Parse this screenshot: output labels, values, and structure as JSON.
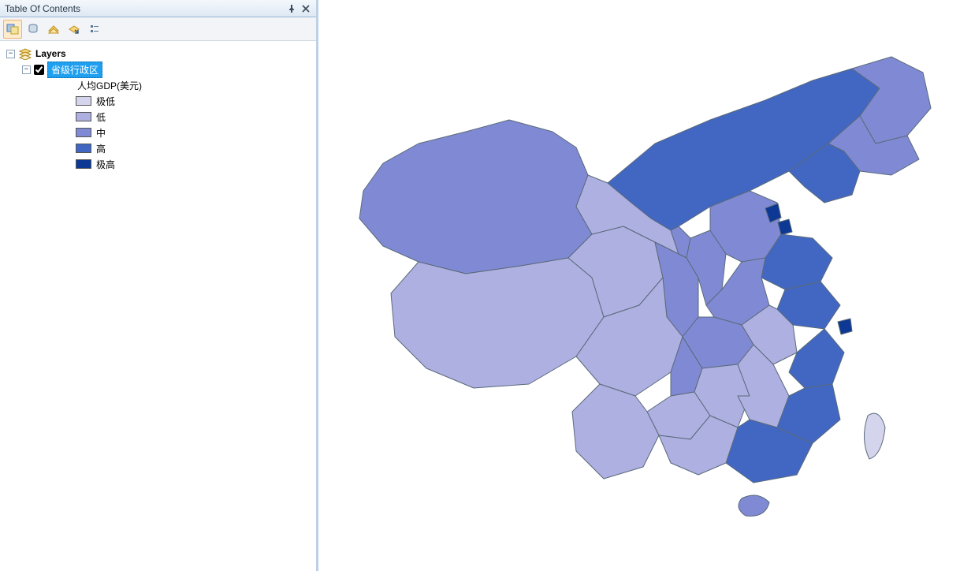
{
  "panel": {
    "title": "Table Of Contents",
    "pin_tooltip": "Auto Hide",
    "close_tooltip": "Close"
  },
  "toolbar": {
    "list_by_drawing_order": "List By Drawing Order",
    "list_by_source": "List By Source",
    "list_by_visibility": "List By Visibility",
    "list_by_selection": "List By Selection",
    "options": "Options"
  },
  "tree": {
    "root_label": "Layers",
    "layer": {
      "name": "省级行政区",
      "checked": true,
      "selected": true,
      "symbology_field": "人均GDP(美元)",
      "classes": [
        {
          "label": "极低",
          "color": "#d4d4ed"
        },
        {
          "label": "低",
          "color": "#aeb0e1"
        },
        {
          "label": "中",
          "color": "#808ad4"
        },
        {
          "label": "高",
          "color": "#4267c2"
        },
        {
          "label": "极高",
          "color": "#0d3894"
        }
      ]
    }
  },
  "map": {
    "theme": "Choropleth of China provinces by per-capita GDP (USD)",
    "legend_field": "人均GDP(美元)",
    "class_colors": {
      "极低": "#d4d4ed",
      "低": "#aeb0e1",
      "中": "#808ad4",
      "高": "#4267c2",
      "极高": "#0d3894"
    },
    "provinces": [
      {
        "name": "Taiwan",
        "class": "极低"
      },
      {
        "name": "Qinghai",
        "class": "低"
      },
      {
        "name": "Tibet",
        "class": "低"
      },
      {
        "name": "Gansu",
        "class": "低"
      },
      {
        "name": "Sichuan",
        "class": "低"
      },
      {
        "name": "Yunnan",
        "class": "低"
      },
      {
        "name": "Guizhou",
        "class": "低"
      },
      {
        "name": "Guangxi",
        "class": "低"
      },
      {
        "name": "Hunan",
        "class": "低"
      },
      {
        "name": "Jiangxi",
        "class": "低"
      },
      {
        "name": "Anhui",
        "class": "低"
      },
      {
        "name": "Xinjiang",
        "class": "中"
      },
      {
        "name": "Ningxia",
        "class": "中"
      },
      {
        "name": "Shaanxi",
        "class": "中"
      },
      {
        "name": "Shanxi",
        "class": "中"
      },
      {
        "name": "Henan",
        "class": "中"
      },
      {
        "name": "Hebei",
        "class": "中"
      },
      {
        "name": "Chongqing",
        "class": "中"
      },
      {
        "name": "Hubei",
        "class": "中"
      },
      {
        "name": "Heilongjiang",
        "class": "中"
      },
      {
        "name": "Jilin",
        "class": "中"
      },
      {
        "name": "Hainan",
        "class": "中"
      },
      {
        "name": "Inner Mongolia",
        "class": "高"
      },
      {
        "name": "Liaoning",
        "class": "高"
      },
      {
        "name": "Shandong",
        "class": "高"
      },
      {
        "name": "Jiangsu",
        "class": "高"
      },
      {
        "name": "Zhejiang",
        "class": "高"
      },
      {
        "name": "Fujian",
        "class": "高"
      },
      {
        "name": "Guangdong",
        "class": "高"
      },
      {
        "name": "Beijing",
        "class": "极高"
      },
      {
        "name": "Tianjin",
        "class": "极高"
      },
      {
        "name": "Shanghai",
        "class": "极高"
      }
    ]
  }
}
